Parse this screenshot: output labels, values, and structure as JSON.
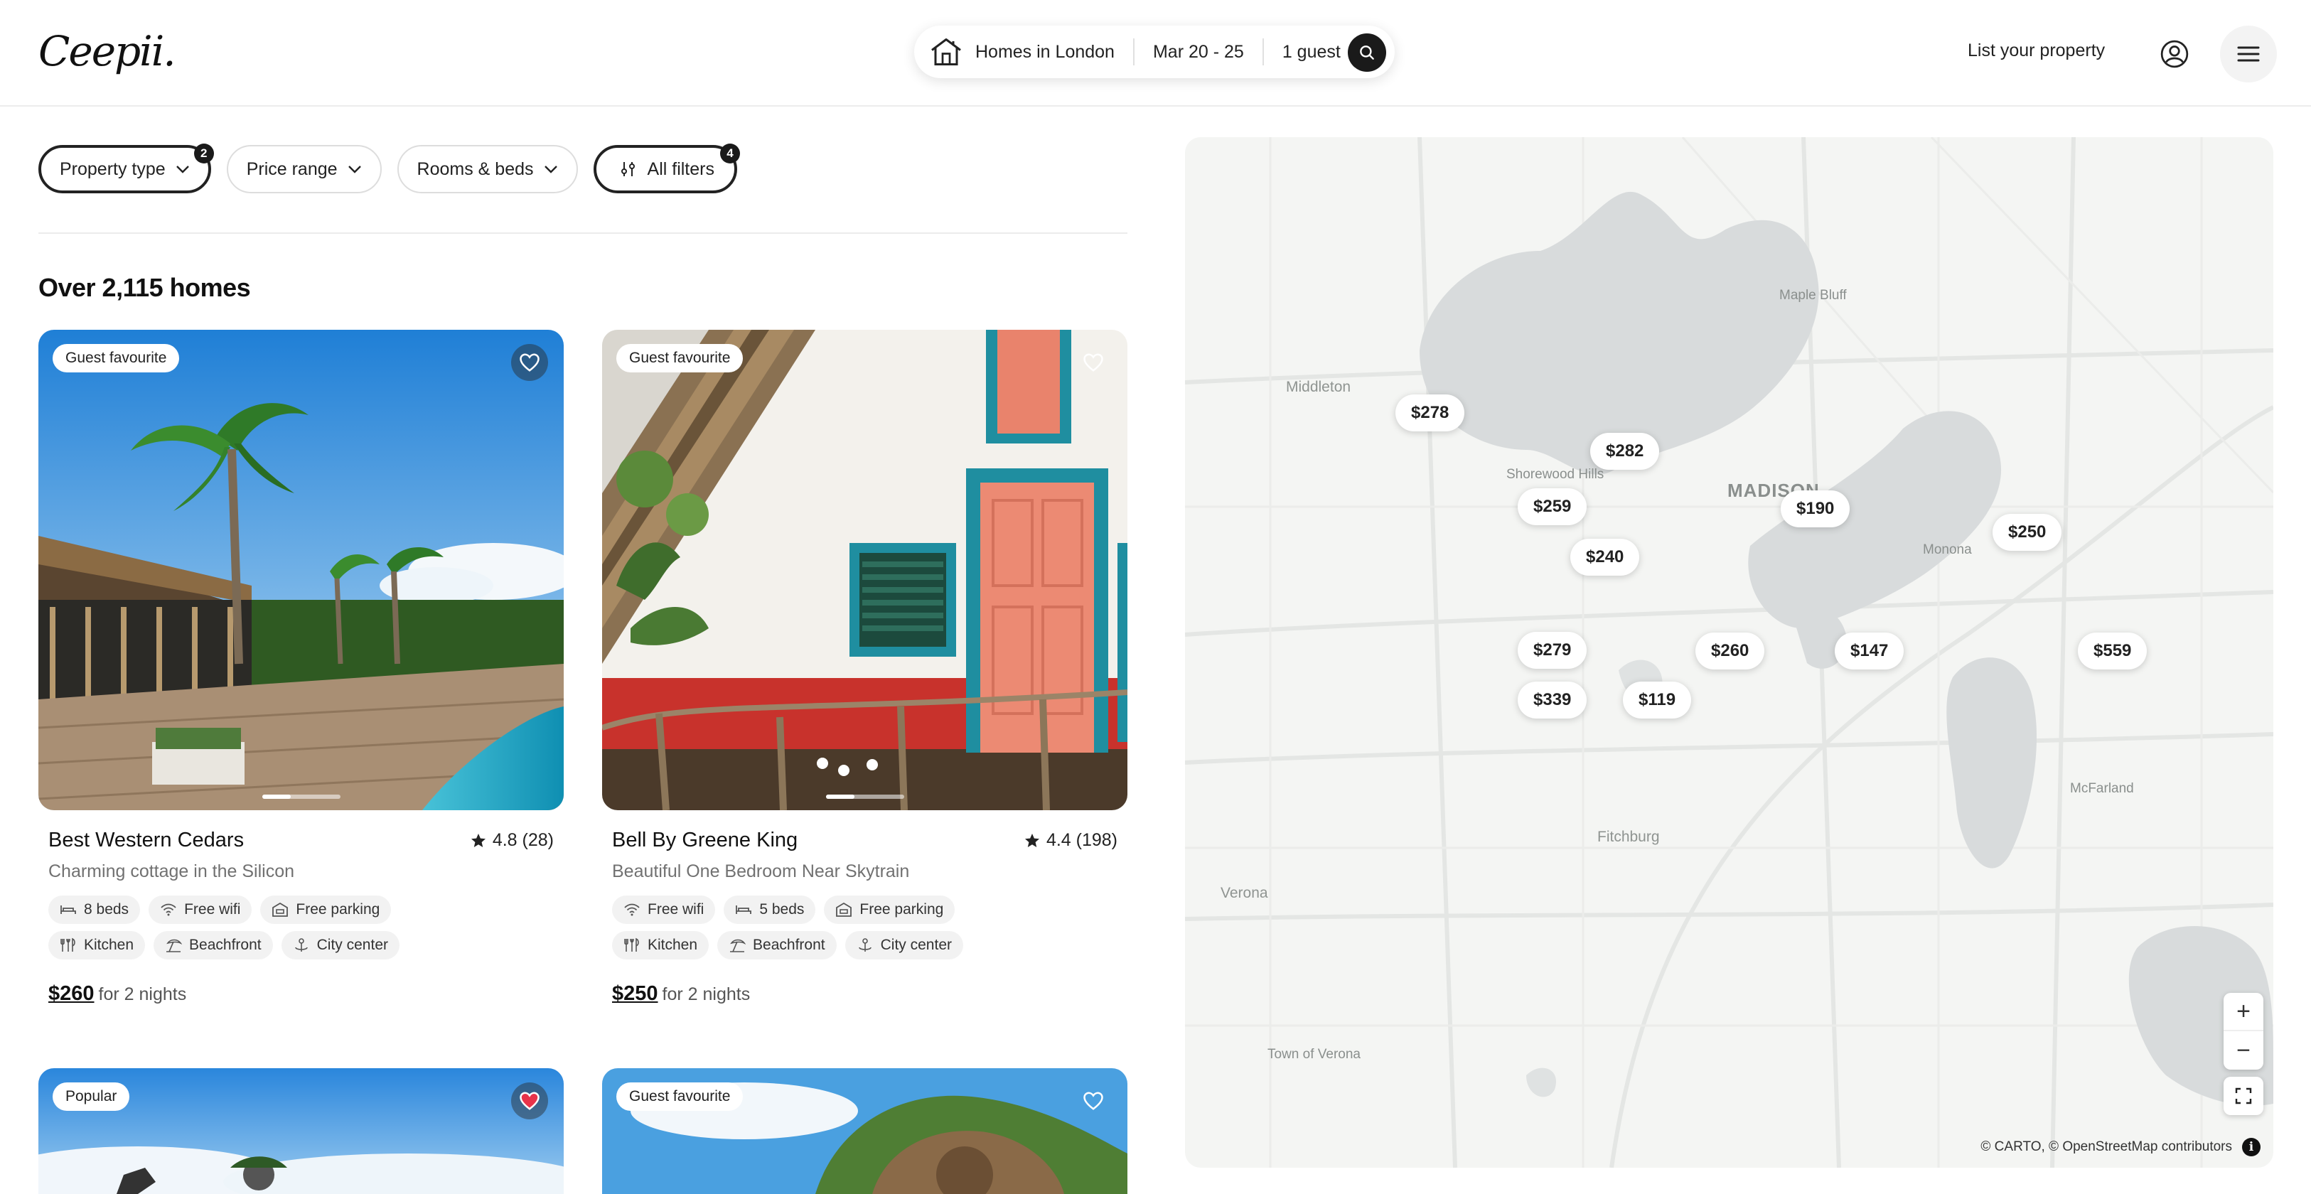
{
  "header": {
    "logo": "Ceepii.",
    "search": {
      "location": "Homes in London",
      "dates": "Mar 20 - 25",
      "guests": "1 guest"
    },
    "list_property": "List your property"
  },
  "filters": [
    {
      "label": "Property type",
      "badge": "2"
    },
    {
      "label": "Price range"
    },
    {
      "label": "Rooms & beds"
    },
    {
      "label": "All filters",
      "badge": "4"
    }
  ],
  "results_count": "Over 2,115 homes",
  "listings": [
    {
      "badge": "Guest favourite",
      "favorited": false,
      "title": "Best Western Cedars",
      "rating": "4.8 (28)",
      "subtitle": "Charming cottage in the Silicon",
      "amenities_row1": [
        {
          "icon": "bed-icon",
          "label": "8 beds"
        },
        {
          "icon": "wifi-icon",
          "label": "Free wifi"
        },
        {
          "icon": "parking-icon",
          "label": "Free parking"
        }
      ],
      "amenities_row2": [
        {
          "icon": "kitchen-icon",
          "label": "Kitchen"
        },
        {
          "icon": "beach-icon",
          "label": "Beachfront"
        },
        {
          "icon": "city-icon",
          "label": "City center"
        }
      ],
      "price": "$260",
      "price_suffix": "for 2 nights"
    },
    {
      "badge": "Guest favourite",
      "favorited": false,
      "title": "Bell By Greene King",
      "rating": "4.4 (198)",
      "subtitle": "Beautiful One Bedroom Near Skytrain",
      "amenities_row1": [
        {
          "icon": "wifi-icon",
          "label": "Free wifi"
        },
        {
          "icon": "bed-icon",
          "label": "5 beds"
        },
        {
          "icon": "parking-icon",
          "label": "Free parking"
        }
      ],
      "amenities_row2": [
        {
          "icon": "kitchen-icon",
          "label": "Kitchen"
        },
        {
          "icon": "beach-icon",
          "label": "Beachfront"
        },
        {
          "icon": "city-icon",
          "label": "City center"
        }
      ],
      "price": "$250",
      "price_suffix": "for 2 nights"
    },
    {
      "badge": "Popular",
      "favorited": true
    },
    {
      "badge": "Guest favourite",
      "favorited": false
    }
  ],
  "map": {
    "markers": [
      "$278",
      "$282",
      "$259",
      "$190",
      "$250",
      "$240",
      "$279",
      "$260",
      "$147",
      "$559",
      "$339",
      "$119"
    ],
    "labels": {
      "middleton": "Middleton",
      "maple_bluff": "Maple Bluff",
      "shorewood": "Shorewood Hills",
      "madison": "MADISON",
      "monona": "Monona",
      "fitchburg": "Fitchburg",
      "verona": "Verona",
      "mcfarland": "McFarland",
      "town_verona": "Town of Verona"
    },
    "attribution": "© CARTO, © OpenStreetMap contributors",
    "zoom_in": "+",
    "zoom_out": "−",
    "water_color": "#d8dbdc",
    "land_color": "#f4f5f3",
    "marker_bg": "#ffffff"
  },
  "colors": {
    "accent": "#1a1a1a",
    "heart_active": "#e8334a",
    "badge_bg": "#ffffff"
  }
}
